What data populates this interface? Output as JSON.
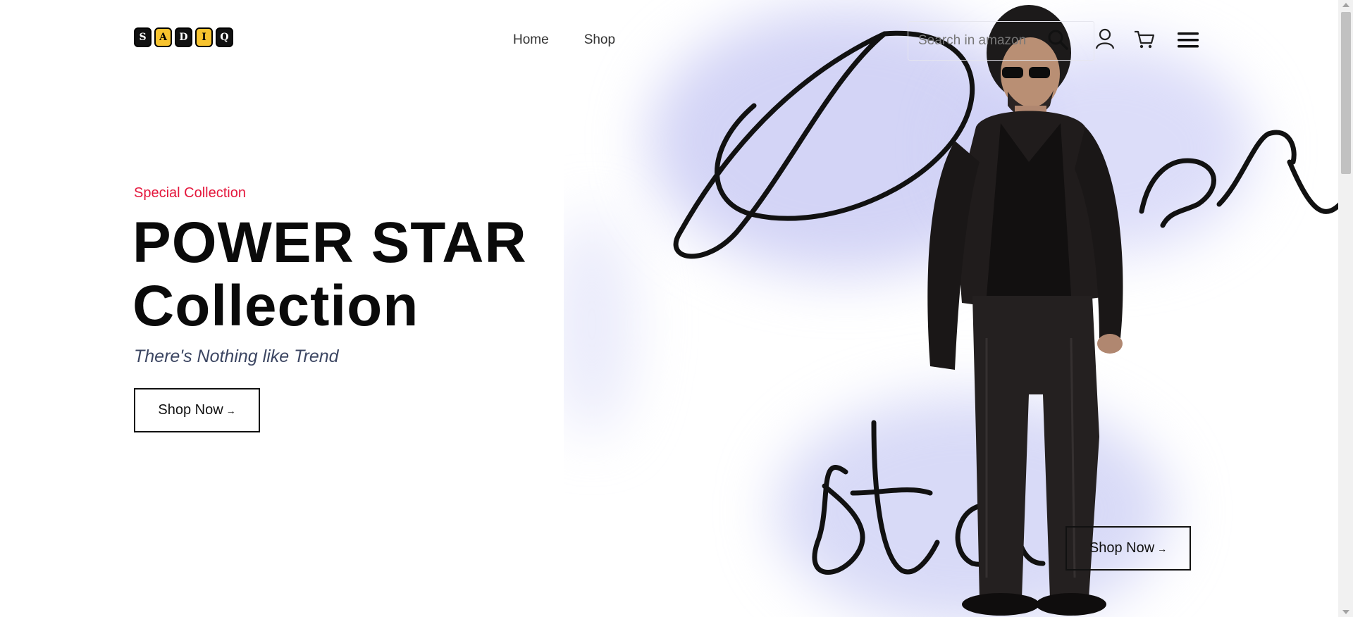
{
  "header": {
    "logo_letters": [
      "S",
      "A",
      "D",
      "I",
      "Q"
    ],
    "nav": [
      {
        "label": "Home"
      },
      {
        "label": "Shop"
      }
    ],
    "search": {
      "placeholder": "Search in amazon",
      "value": ""
    },
    "icons": [
      "search-icon",
      "user-icon",
      "cart-icon",
      "menu-icon"
    ]
  },
  "hero": {
    "eyebrow": "Special Collection",
    "headline_line1": "POWER STAR",
    "headline_line2": "Collection",
    "tagline": "There's Nothing like Trend",
    "primary_button": "Shop Now",
    "secondary_button": "Shop Now",
    "arrow_glyph": "→"
  },
  "colors": {
    "accent": "#e4173c",
    "logo_yellow": "#f7c32e",
    "text": "#0a0a0a",
    "tagline": "#3c4662",
    "blob": "#c4c6f3"
  }
}
